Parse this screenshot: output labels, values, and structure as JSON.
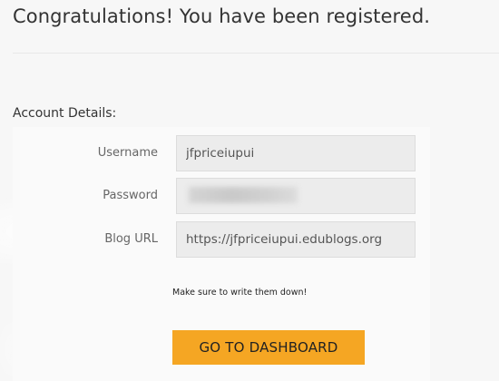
{
  "header": {
    "title": "Congratulations! You have been registered."
  },
  "account": {
    "section_title": "Account Details:",
    "fields": {
      "username": {
        "label": "Username",
        "value": "jfpriceiupui"
      },
      "password": {
        "label": "Password",
        "value": ""
      },
      "blog_url": {
        "label": "Blog URL",
        "value": "https://jfpriceiupui.edublogs.org"
      }
    },
    "note": "Make sure to write them down!"
  },
  "actions": {
    "dashboard_label": "GO TO DASHBOARD"
  },
  "colors": {
    "accent": "#f5a623",
    "page_background": "#f7f7f7",
    "input_background": "#ececec"
  }
}
